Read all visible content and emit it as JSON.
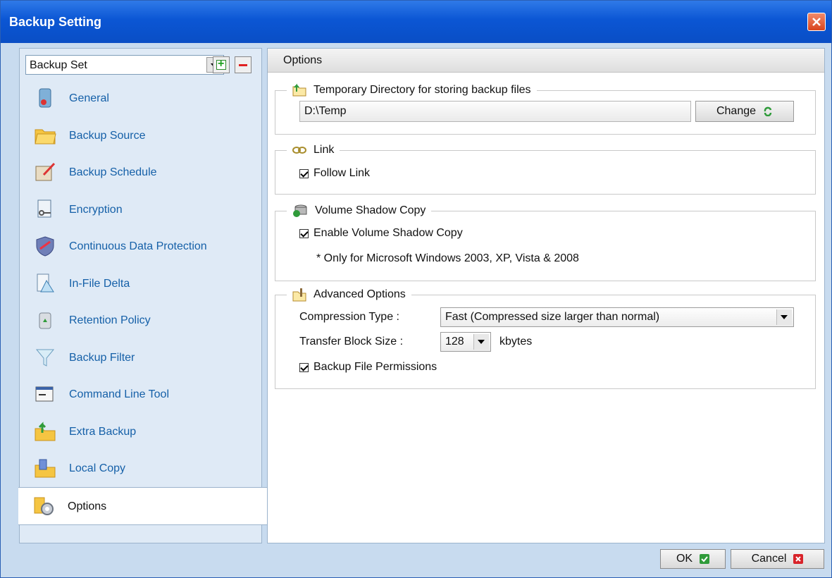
{
  "window": {
    "title": "Backup Setting"
  },
  "left": {
    "backup_set_label": "Backup Set",
    "add_label": "+",
    "items": [
      {
        "label": "General",
        "icon": "general-icon"
      },
      {
        "label": "Backup Source",
        "icon": "folder-icon"
      },
      {
        "label": "Backup Schedule",
        "icon": "schedule-icon"
      },
      {
        "label": "Encryption",
        "icon": "encryption-icon"
      },
      {
        "label": "Continuous Data Protection",
        "icon": "shield-icon"
      },
      {
        "label": "In-File Delta",
        "icon": "delta-icon"
      },
      {
        "label": "Retention Policy",
        "icon": "recycle-bin-icon"
      },
      {
        "label": "Backup Filter",
        "icon": "funnel-icon"
      },
      {
        "label": "Command Line Tool",
        "icon": "command-line-icon"
      },
      {
        "label": "Extra Backup",
        "icon": "extra-backup-icon"
      },
      {
        "label": "Local Copy",
        "icon": "local-copy-icon"
      },
      {
        "label": "Options",
        "icon": "options-icon"
      }
    ]
  },
  "right": {
    "header": "Options",
    "temp_dir": {
      "legend": "Temporary Directory for storing backup files",
      "value": "D:\\Temp",
      "change_label": "Change"
    },
    "link": {
      "legend": "Link",
      "follow_label": "Follow Link"
    },
    "vss": {
      "legend": "Volume Shadow Copy",
      "enable_label": "Enable Volume Shadow Copy",
      "note": "* Only for Microsoft Windows 2003, XP, Vista & 2008"
    },
    "advanced": {
      "legend": "Advanced Options",
      "compression_label": "Compression Type :",
      "compression_value": "Fast (Compressed size larger than normal)",
      "block_label": "Transfer Block Size :",
      "block_value": "128",
      "block_unit": "kbytes",
      "permissions_label": "Backup File Permissions"
    }
  },
  "footer": {
    "ok_label": "OK",
    "cancel_label": "Cancel"
  },
  "colors": {
    "title_bar": "#0b56d4",
    "nav_text": "#1560a8",
    "close": "#d9441c"
  }
}
